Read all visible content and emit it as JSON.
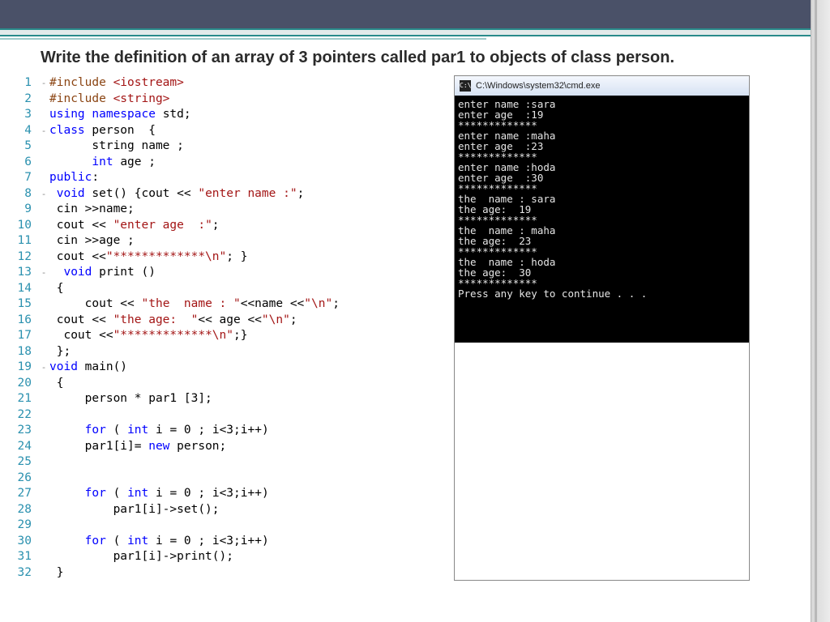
{
  "title": "Write the definition of an array of 3 pointers called par1  to objects of class person.",
  "code": {
    "lines": [
      {
        "n": 1,
        "fold": "-",
        "mark": "g",
        "pre": "#include",
        "t": " <iostream>"
      },
      {
        "n": 2,
        "fold": "",
        "mark": "g",
        "pre": "#include",
        "t": " <string>"
      },
      {
        "n": 3,
        "fold": "",
        "mark": "g",
        "html": "<span class='kw'>using</span> <span class='kw'>namespace</span> std;"
      },
      {
        "n": 4,
        "fold": "-",
        "mark": "g",
        "html": "<span class='kw'>class</span> person  {"
      },
      {
        "n": 5,
        "fold": "",
        "mark": "g",
        "html": "      string name ;"
      },
      {
        "n": 6,
        "fold": "",
        "mark": "g",
        "html": "      <span class='kw'>int</span> age ;"
      },
      {
        "n": 7,
        "fold": "",
        "mark": "g",
        "html": "<span class='kw'>public</span>:"
      },
      {
        "n": 8,
        "fold": "-",
        "mark": "g",
        "html": " <span class='kw'>void</span> set() {cout &lt;&lt; <span class='str'>\"enter name :\"</span>;"
      },
      {
        "n": 9,
        "fold": "",
        "mark": "g",
        "html": " cin &gt;&gt;name;"
      },
      {
        "n": 10,
        "fold": "",
        "mark": "g",
        "html": " cout &lt;&lt; <span class='str'>\"enter age  :\"</span>;"
      },
      {
        "n": 11,
        "fold": "",
        "mark": "g",
        "html": " cin &gt;&gt;age ;"
      },
      {
        "n": 12,
        "fold": "",
        "mark": "y",
        "html": " cout &lt;&lt;<span class='str'>\"*************\\n\"</span>; }"
      },
      {
        "n": 13,
        "fold": "-",
        "mark": "g",
        "html": "  <span class='kw'>void</span> print ()"
      },
      {
        "n": 14,
        "fold": "",
        "mark": "g",
        "html": " {"
      },
      {
        "n": 15,
        "fold": "",
        "mark": "g",
        "html": "     cout &lt;&lt; <span class='str'>\"the  name : \"</span>&lt;&lt;name &lt;&lt;<span class='str'>\"\\n\"</span>;"
      },
      {
        "n": 16,
        "fold": "",
        "mark": "g",
        "html": " cout &lt;&lt; <span class='str'>\"the age:  \"</span>&lt;&lt; age &lt;&lt;<span class='str'>\"\\n\"</span>;"
      },
      {
        "n": 17,
        "fold": "",
        "mark": "y",
        "html": "  cout &lt;&lt;<span class='str'>\"*************\\n\"</span>;}"
      },
      {
        "n": 18,
        "fold": "",
        "mark": "y",
        "html": " };"
      },
      {
        "n": 19,
        "fold": "-",
        "mark": "g",
        "html": "<span class='kw'>void</span> main()"
      },
      {
        "n": 20,
        "fold": "",
        "mark": "g",
        "html": " {"
      },
      {
        "n": 21,
        "fold": "",
        "mark": "y",
        "html": "     person * par1 [3];"
      },
      {
        "n": 22,
        "fold": "",
        "mark": "y",
        "html": ""
      },
      {
        "n": 23,
        "fold": "",
        "mark": "y",
        "html": "     <span class='kw'>for</span> ( <span class='kw'>int</span> i = 0 ; i&lt;3;i++)"
      },
      {
        "n": 24,
        "fold": "",
        "mark": "y",
        "html": "     par1[i]= <span class='kw'>new</span> person;"
      },
      {
        "n": 25,
        "fold": "",
        "mark": "y",
        "html": ""
      },
      {
        "n": 26,
        "fold": "",
        "mark": "y",
        "html": ""
      },
      {
        "n": 27,
        "fold": "",
        "mark": "y",
        "html": "     <span class='kw'>for</span> ( <span class='kw'>int</span> i = 0 ; i&lt;3;i++)"
      },
      {
        "n": 28,
        "fold": "",
        "mark": "y",
        "html": "         par1[i]-&gt;set();"
      },
      {
        "n": 29,
        "fold": "",
        "mark": "y",
        "html": ""
      },
      {
        "n": 30,
        "fold": "",
        "mark": "y",
        "html": "     <span class='kw'>for</span> ( <span class='kw'>int</span> i = 0 ; i&lt;3;i++)"
      },
      {
        "n": 31,
        "fold": "",
        "mark": "y",
        "html": "         par1[i]-&gt;print();"
      },
      {
        "n": 32,
        "fold": "",
        "mark": "g",
        "html": " }"
      }
    ]
  },
  "console": {
    "title": "C:\\Windows\\system32\\cmd.exe",
    "body": "enter name :sara\nenter age  :19\n*************\nenter name :maha\nenter age  :23\n*************\nenter name :hoda\nenter age  :30\n*************\nthe  name : sara\nthe age:  19\n*************\nthe  name : maha\nthe age:  23\n*************\nthe  name : hoda\nthe age:  30\n*************\nPress any key to continue . . ."
  }
}
